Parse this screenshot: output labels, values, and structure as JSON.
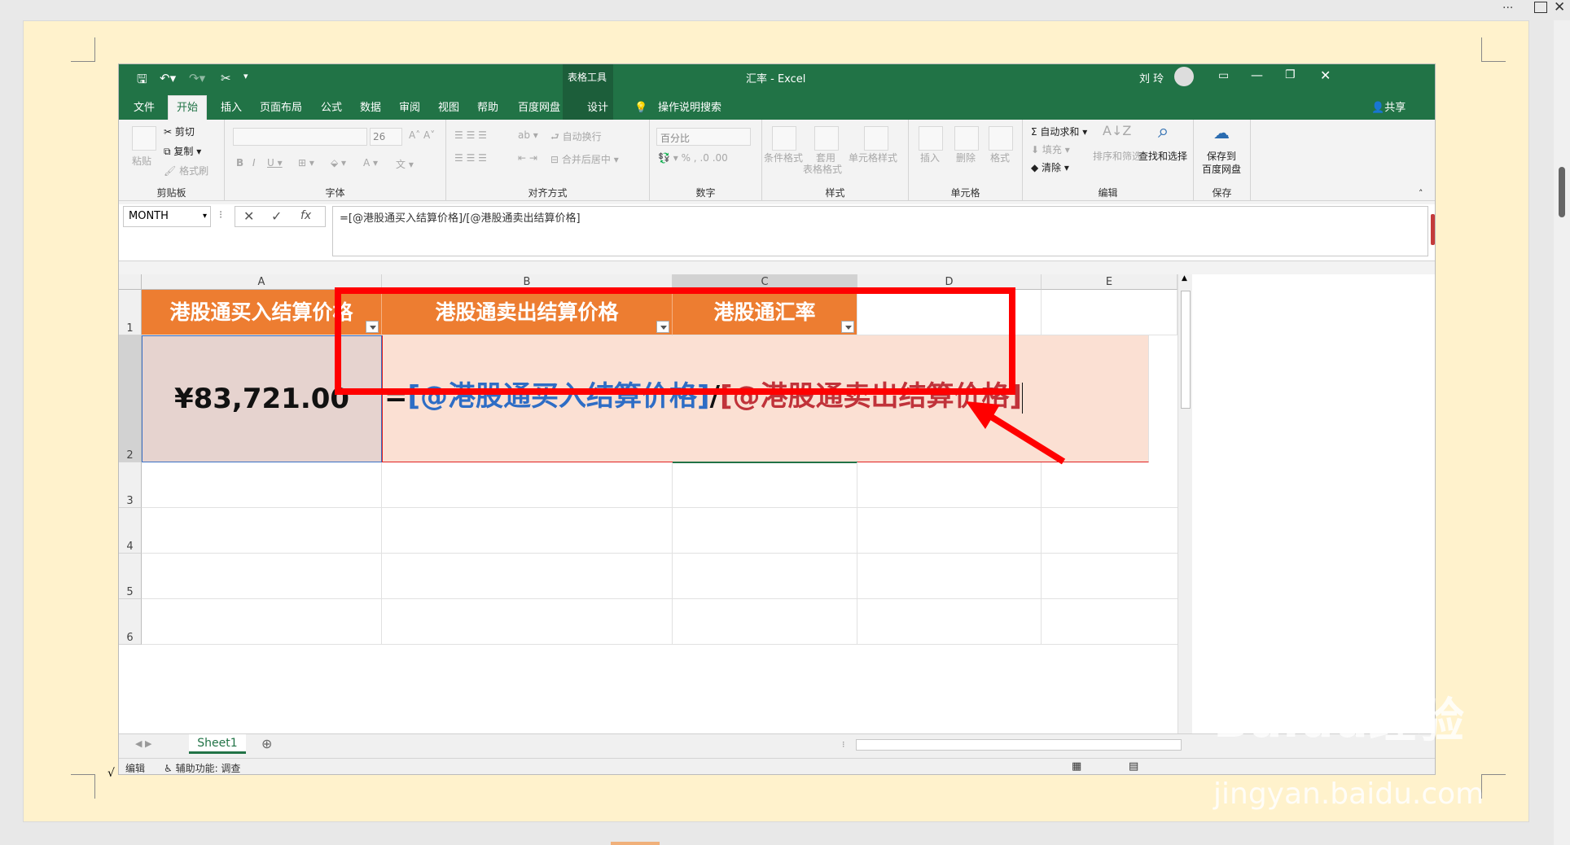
{
  "window": {
    "title": "汇率 - Excel",
    "context_tab": "表格工具",
    "user": "刘 玲"
  },
  "tabs": [
    "文件",
    "开始",
    "插入",
    "页面布局",
    "公式",
    "数据",
    "审阅",
    "视图",
    "帮助",
    "百度网盘",
    "设计"
  ],
  "tell_me": "操作说明搜索",
  "share": "共享",
  "ribbon": {
    "clipboard": {
      "paste": "粘贴",
      "cut": "剪切",
      "copy": "复制",
      "format_painter": "格式刷",
      "label": "剪贴板"
    },
    "font": {
      "size": "26",
      "label": "字体"
    },
    "alignment": {
      "wrap": "自动换行",
      "merge": "合并后居中",
      "label": "对齐方式"
    },
    "number": {
      "format": "百分比",
      "label": "数字"
    },
    "styles": {
      "conditional": "条件格式",
      "table_format_1": "套用",
      "table_format_2": "表格格式",
      "cell_styles": "单元格样式",
      "label": "样式"
    },
    "cells": {
      "insert": "插入",
      "delete": "删除",
      "format": "格式",
      "label": "单元格"
    },
    "editing": {
      "autosum": "自动求和",
      "fill": "填充",
      "clear": "清除",
      "sort": "排序和筛选",
      "find": "查找和选择",
      "label": "编辑"
    },
    "save": {
      "line1": "保存到",
      "line2": "百度网盘",
      "label": "保存"
    }
  },
  "formula_bar": {
    "name_box": "MONTH",
    "formula": "=[@港股通买入结算价格]/[@港股通卖出结算价格]"
  },
  "columns": [
    "A",
    "B",
    "C",
    "D",
    "E"
  ],
  "rows": [
    "1",
    "2",
    "3",
    "4",
    "5",
    "6"
  ],
  "table": {
    "headers": [
      "港股通买入结算价格",
      "港股通卖出结算价格",
      "港股通汇率"
    ],
    "a2": "¥83,721.00",
    "edit": {
      "eq": "=",
      "ref1": "[@港股通买入结算价格]",
      "slash": "/",
      "ref2": "[@港股通卖出结算价格]"
    }
  },
  "sheet_tab": "Sheet1",
  "status": {
    "mode": "编辑",
    "accessibility": "辅助功能: 调查"
  },
  "colors": {
    "excel_green": "#217346",
    "header_orange": "#ed7d31",
    "highlight": "#ff0000",
    "ref1": "#2e6dc5",
    "ref2": "#c0333a"
  },
  "watermark": {
    "brand": "Baidu经验",
    "url": "jingyan.baidu.com"
  }
}
